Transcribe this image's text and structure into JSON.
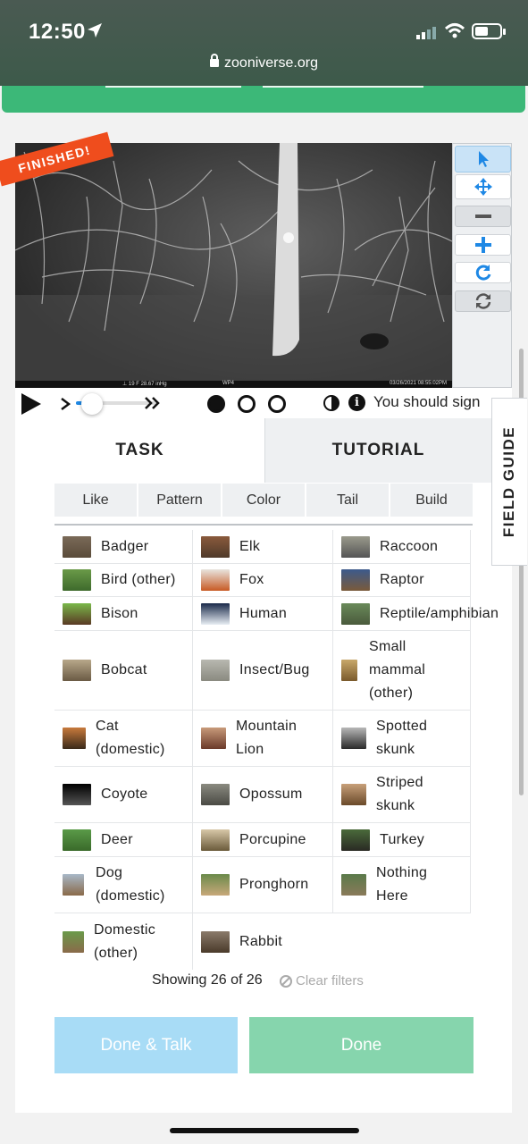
{
  "status_bar": {
    "time": "12:50"
  },
  "browser": {
    "url": "zooniverse.org"
  },
  "subject": {
    "badge": "FINISHED!",
    "camera_info": {
      "left": "⊥ 19 F  28.67 inHg",
      "middle": "WP4",
      "right": "03/26/2021 08:55:02PM"
    }
  },
  "tools": [
    {
      "name": "pointer",
      "icon": "arrow-pointer-icon"
    },
    {
      "name": "move",
      "icon": "move-arrows-icon"
    },
    {
      "name": "zoom-out",
      "icon": "minus-icon"
    },
    {
      "name": "zoom-in",
      "icon": "plus-icon"
    },
    {
      "name": "rotate",
      "icon": "rotate-icon"
    },
    {
      "name": "reset",
      "icon": "refresh-icon"
    }
  ],
  "player": {
    "signin_text": "You should sign"
  },
  "tabs": {
    "task": "TASK",
    "tutorial": "TUTORIAL",
    "field_guide": "FIELD GUIDE"
  },
  "filters": [
    "Like",
    "Pattern",
    "Color",
    "Tail",
    "Build"
  ],
  "choices": [
    {
      "col0": "Badger",
      "col1": "Elk",
      "col2": "Raccoon"
    },
    {
      "col0": "Bird (other)",
      "col1": "Fox",
      "col2": "Raptor"
    },
    {
      "col0": "Bison",
      "col1": "Human",
      "col2": "Reptile/amphibian"
    },
    {
      "col0": "Bobcat",
      "col1": "Insect/Bug",
      "col2": "Small mammal (other)"
    },
    {
      "col0": "Cat (domestic)",
      "col1": "Mountain Lion",
      "col2": "Spotted skunk"
    },
    {
      "col0": "Coyote",
      "col1": "Opossum",
      "col2": "Striped skunk"
    },
    {
      "col0": "Deer",
      "col1": "Porcupine",
      "col2": "Turkey"
    },
    {
      "col0": "Dog (domestic)",
      "col1": "Pronghorn",
      "col2": "Nothing Here"
    },
    {
      "col0": "Domestic (other)",
      "col1": "Rabbit",
      "col2": ""
    }
  ],
  "showing": {
    "prefix": "Showing",
    "shown": "26",
    "of": "of",
    "total": "26",
    "clear_label": "Clear filters"
  },
  "buttons": {
    "done_talk": "Done & Talk",
    "done": "Done"
  },
  "colors": {
    "brand_green": "#3cb878",
    "finished_orange": "#ef4d1d",
    "talk_blue": "#a8dcf6",
    "done_green": "#86d5ad",
    "tool_blue": "#1e88e5"
  }
}
